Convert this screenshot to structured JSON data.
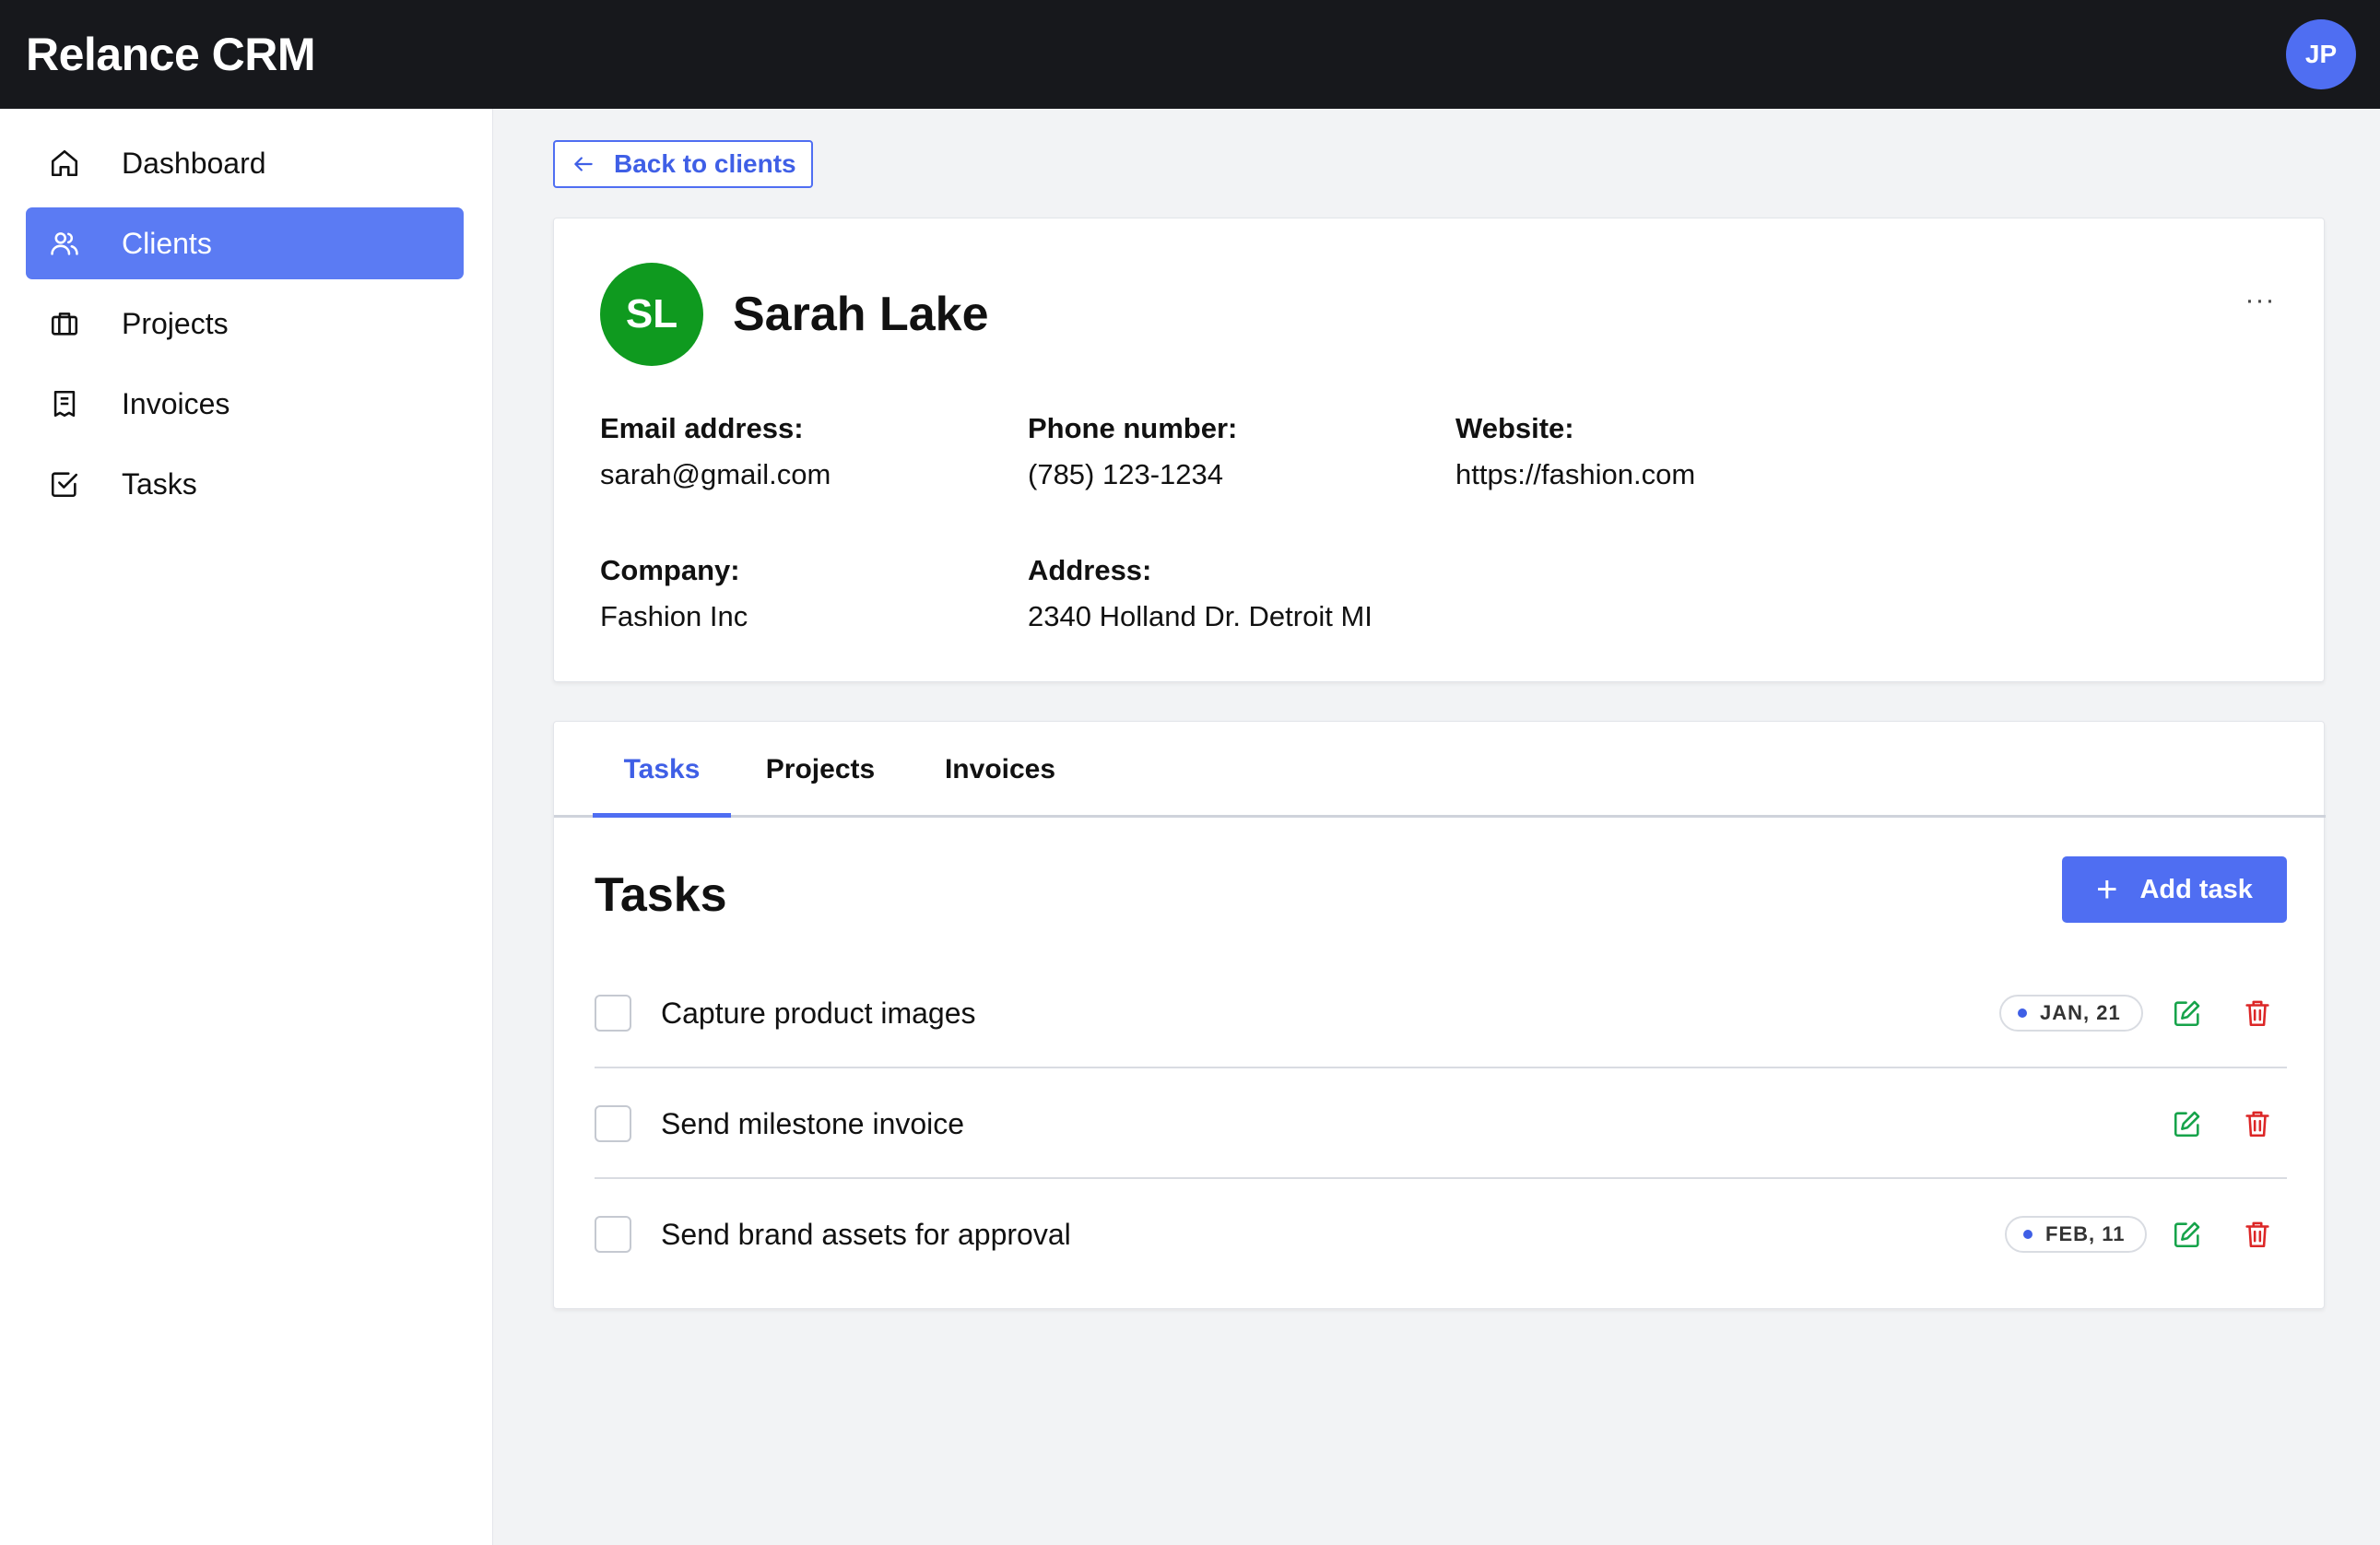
{
  "app": {
    "brand": "Relance CRM",
    "user_initials": "JP",
    "accent_color": "#4f6ef2"
  },
  "sidebar": {
    "items": [
      {
        "label": "Dashboard",
        "icon": "home-icon",
        "active": false
      },
      {
        "label": "Clients",
        "icon": "users-icon",
        "active": true
      },
      {
        "label": "Projects",
        "icon": "briefcase-icon",
        "active": false
      },
      {
        "label": "Invoices",
        "icon": "receipt-icon",
        "active": false
      },
      {
        "label": "Tasks",
        "icon": "checkbox-icon",
        "active": false
      }
    ]
  },
  "back_button": {
    "label": "Back to clients",
    "icon": "arrow-left-icon"
  },
  "client": {
    "initials": "SL",
    "name": "Sarah Lake",
    "avatar_color": "#0f9a1f",
    "more_label": "···",
    "fields": {
      "email": {
        "label": "Email address:",
        "value": "sarah@gmail.com"
      },
      "phone": {
        "label": "Phone number:",
        "value": "(785) 123-1234"
      },
      "website": {
        "label": "Website:",
        "value": "https://fashion.com"
      },
      "company": {
        "label": "Company:",
        "value": "Fashion Inc"
      },
      "address": {
        "label": "Address:",
        "value": "2340 Holland Dr. Detroit MI"
      }
    }
  },
  "tabs": [
    {
      "label": "Tasks",
      "active": true
    },
    {
      "label": "Projects",
      "active": false
    },
    {
      "label": "Invoices",
      "active": false
    }
  ],
  "tasks_section": {
    "title": "Tasks",
    "add_button": {
      "plus": "+",
      "label": "Add task"
    },
    "tasks": [
      {
        "title": "Capture product images",
        "date": "JAN, 21",
        "checked": false
      },
      {
        "title": "Send milestone invoice",
        "date": "",
        "checked": false
      },
      {
        "title": "Send brand assets for approval",
        "date": "FEB, 11",
        "checked": false
      }
    ],
    "edit_icon_color": "#16a34a",
    "delete_icon_color": "#dc2626"
  }
}
